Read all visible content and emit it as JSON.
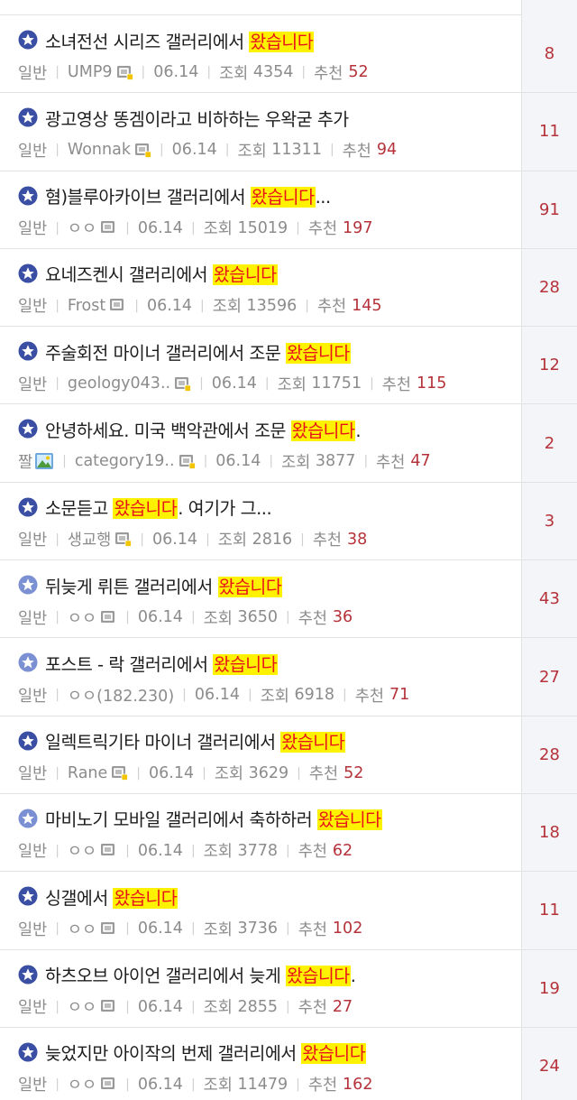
{
  "labels": {
    "views": "조회",
    "recommend": "추천"
  },
  "colors": {
    "accent_red": "#e8141b",
    "highlight": "#fff200",
    "count_red": "#b5323a",
    "badge_blue": "#3a4fa3",
    "badge_light": "#7b90d3"
  },
  "posts": [
    {
      "title": [
        "소녀전선 시리즈 갤러리에서 ",
        "왔습니다",
        ""
      ],
      "category": "일반",
      "author": "UMP9",
      "author_icon": "nik",
      "date": "06.14",
      "views": "4354",
      "recommend": "52",
      "comments": "8",
      "badge": "dark"
    },
    {
      "title": [
        "광고영상 똥겜이라고 비하하는 우왁굳 추가",
        "",
        ""
      ],
      "category": "일반",
      "author": "Wonnak",
      "author_icon": "nik",
      "date": "06.14",
      "views": "11311",
      "recommend": "94",
      "comments": "11",
      "badge": "dark"
    },
    {
      "title": [
        "혐)블루아카이브 갤러리에서 ",
        "왔습니다",
        "..."
      ],
      "category": "일반",
      "author": "ㅇㅇ",
      "author_icon": "nik-plain",
      "date": "06.14",
      "views": "15019",
      "recommend": "197",
      "comments": "91",
      "badge": "dark"
    },
    {
      "title": [
        "요네즈켄시 갤러리에서 ",
        "왔습니다",
        ""
      ],
      "category": "일반",
      "author": "Frost",
      "author_icon": "nik-plain",
      "date": "06.14",
      "views": "13596",
      "recommend": "145",
      "comments": "28",
      "badge": "dark"
    },
    {
      "title": [
        "주술회전 마이너 갤러리에서 조문 ",
        "왔습니다",
        ""
      ],
      "category": "일반",
      "author": "geology043..",
      "author_icon": "nik",
      "date": "06.14",
      "views": "11751",
      "recommend": "115",
      "comments": "12",
      "badge": "dark"
    },
    {
      "title": [
        "안녕하세요. 미국 백악관에서 조문 ",
        "왔습니다",
        "."
      ],
      "category": "짤",
      "author": "category19..",
      "author_icon": "nik",
      "date": "06.14",
      "views": "3877",
      "recommend": "47",
      "comments": "2",
      "badge": "dark",
      "category_icon": true
    },
    {
      "title": [
        "소문듣고 ",
        "왔습니다",
        ". 여기가 그..."
      ],
      "category": "일반",
      "author": "생교행",
      "author_icon": "nik",
      "date": "06.14",
      "views": "2816",
      "recommend": "38",
      "comments": "3",
      "badge": "dark"
    },
    {
      "title": [
        "뒤늦게 뤼튼 갤러리에서 ",
        "왔습니다",
        ""
      ],
      "category": "일반",
      "author": "ㅇㅇ",
      "author_icon": "nik-plain",
      "date": "06.14",
      "views": "3650",
      "recommend": "36",
      "comments": "43",
      "badge": "light"
    },
    {
      "title": [
        "포스트 - 락 갤러리에서 ",
        "왔습니다",
        ""
      ],
      "category": "일반",
      "author": "ㅇㅇ(182.230)",
      "author_icon": "",
      "date": "06.14",
      "views": "6918",
      "recommend": "71",
      "comments": "27",
      "badge": "light"
    },
    {
      "title": [
        "일렉트릭기타 마이너 갤러리에서 ",
        "왔습니다",
        ""
      ],
      "category": "일반",
      "author": "Rane",
      "author_icon": "nik",
      "date": "06.14",
      "views": "3629",
      "recommend": "52",
      "comments": "28",
      "badge": "dark"
    },
    {
      "title": [
        "마비노기 모바일 갤러리에서 축하하러 ",
        "왔습니다",
        ""
      ],
      "category": "일반",
      "author": "ㅇㅇ",
      "author_icon": "nik-plain",
      "date": "06.14",
      "views": "3778",
      "recommend": "62",
      "comments": "18",
      "badge": "light"
    },
    {
      "title": [
        "싱갤에서 ",
        "왔습니다",
        ""
      ],
      "category": "일반",
      "author": "ㅇㅇ",
      "author_icon": "nik-plain",
      "date": "06.14",
      "views": "3736",
      "recommend": "102",
      "comments": "11",
      "badge": "dark"
    },
    {
      "title": [
        "하츠오브 아이언 갤러리에서 늦게 ",
        "왔습니다",
        "."
      ],
      "category": "일반",
      "author": "ㅇㅇ",
      "author_icon": "nik-plain",
      "date": "06.14",
      "views": "2855",
      "recommend": "27",
      "comments": "19",
      "badge": "dark"
    },
    {
      "title": [
        "늦었지만 아이작의 번제 갤러리에서 ",
        "왔습니다",
        ""
      ],
      "category": "일반",
      "author": "ㅇㅇ",
      "author_icon": "nik-plain",
      "date": "06.14",
      "views": "11479",
      "recommend": "162",
      "comments": "24",
      "badge": "dark"
    }
  ]
}
